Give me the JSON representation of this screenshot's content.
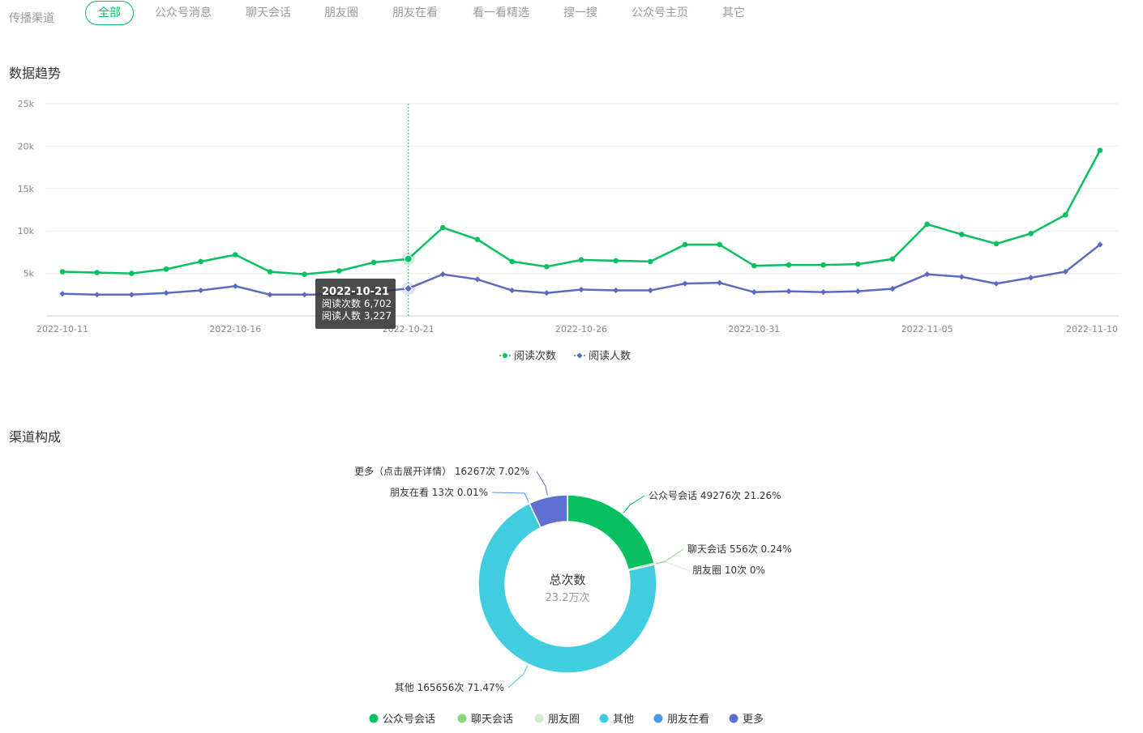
{
  "filter": {
    "label": "传播渠道",
    "tabs": [
      {
        "label": "全部",
        "active": true
      },
      {
        "label": "公众号消息",
        "active": false
      },
      {
        "label": "聊天会话",
        "active": false
      },
      {
        "label": "朋友圈",
        "active": false
      },
      {
        "label": "朋友在看",
        "active": false
      },
      {
        "label": "看一看精选",
        "active": false
      },
      {
        "label": "搜一搜",
        "active": false
      },
      {
        "label": "公众号主页",
        "active": false
      },
      {
        "label": "其它",
        "active": false
      }
    ]
  },
  "sections": {
    "trend_title": "数据趋势",
    "channel_title": "渠道构成"
  },
  "tooltip": {
    "date": "2022-10-21",
    "line1": "阅读次数 6,702",
    "line2": "阅读人数 3,227"
  },
  "donut_center": {
    "title": "总次数",
    "value": "23.2万次"
  },
  "chart_data": [
    {
      "type": "line",
      "x": [
        "2022-10-11",
        "2022-10-12",
        "2022-10-13",
        "2022-10-14",
        "2022-10-15",
        "2022-10-16",
        "2022-10-17",
        "2022-10-18",
        "2022-10-19",
        "2022-10-20",
        "2022-10-21",
        "2022-10-22",
        "2022-10-23",
        "2022-10-24",
        "2022-10-25",
        "2022-10-26",
        "2022-10-27",
        "2022-10-28",
        "2022-10-29",
        "2022-10-30",
        "2022-10-31",
        "2022-11-01",
        "2022-11-02",
        "2022-11-03",
        "2022-11-04",
        "2022-11-05",
        "2022-11-06",
        "2022-11-07",
        "2022-11-08",
        "2022-11-09",
        "2022-11-10"
      ],
      "x_tick_labels": [
        "2022-10-11",
        "2022-10-16",
        "2022-10-21",
        "2022-10-26",
        "2022-10-31",
        "2022-11-05",
        "2022-11-10"
      ],
      "y_ticks": [
        5000,
        10000,
        15000,
        20000,
        25000
      ],
      "y_tick_labels": [
        "5k",
        "10k",
        "15k",
        "20k",
        "25k"
      ],
      "ylim": [
        0,
        25000
      ],
      "grid": true,
      "legend_position": "bottom",
      "series": [
        {
          "name": "阅读次数",
          "color": "#07c160",
          "marker": "circle",
          "values": [
            5200,
            5100,
            5000,
            5500,
            6400,
            7200,
            5200,
            4900,
            5300,
            6300,
            6702,
            10400,
            9000,
            6400,
            5800,
            6600,
            6500,
            6400,
            8400,
            8400,
            5900,
            6000,
            6000,
            6100,
            6700,
            10800,
            9600,
            8500,
            9700,
            11900,
            19500
          ]
        },
        {
          "name": "阅读人数",
          "color": "#5c6bc0",
          "marker": "diamond",
          "values": [
            2600,
            2500,
            2500,
            2700,
            3000,
            3500,
            2500,
            2500,
            2500,
            2800,
            3227,
            4900,
            4300,
            3000,
            2700,
            3100,
            3000,
            3000,
            3800,
            3900,
            2800,
            2900,
            2800,
            2900,
            3200,
            4900,
            4600,
            3800,
            4500,
            5200,
            8400
          ]
        }
      ]
    },
    {
      "type": "pie",
      "donut": true,
      "slices": [
        {
          "name": "公众号会话",
          "label": "公众号会话 49276次 21.26%",
          "value": 49276,
          "percent": 21.26,
          "color": "#07c160"
        },
        {
          "name": "聊天会话",
          "label": "聊天会话 556次 0.24%",
          "value": 556,
          "percent": 0.24,
          "color": "#8bd580"
        },
        {
          "name": "朋友圈",
          "label": "朋友圈 10次 0%",
          "value": 10,
          "percent": 0,
          "color": "#cfeecf"
        },
        {
          "name": "其他",
          "label": "其他 165656次 71.47%",
          "value": 165656,
          "percent": 71.47,
          "color": "#40cde0"
        },
        {
          "name": "朋友在看",
          "label": "朋友在看 13次 0.01%",
          "value": 13,
          "percent": 0.01,
          "color": "#4a99ea"
        },
        {
          "name": "更多",
          "label": "更多（点击展开详情） 16267次 7.02%",
          "value": 16267,
          "percent": 7.02,
          "color": "#5e6fd1"
        }
      ],
      "legend_position": "bottom"
    }
  ]
}
